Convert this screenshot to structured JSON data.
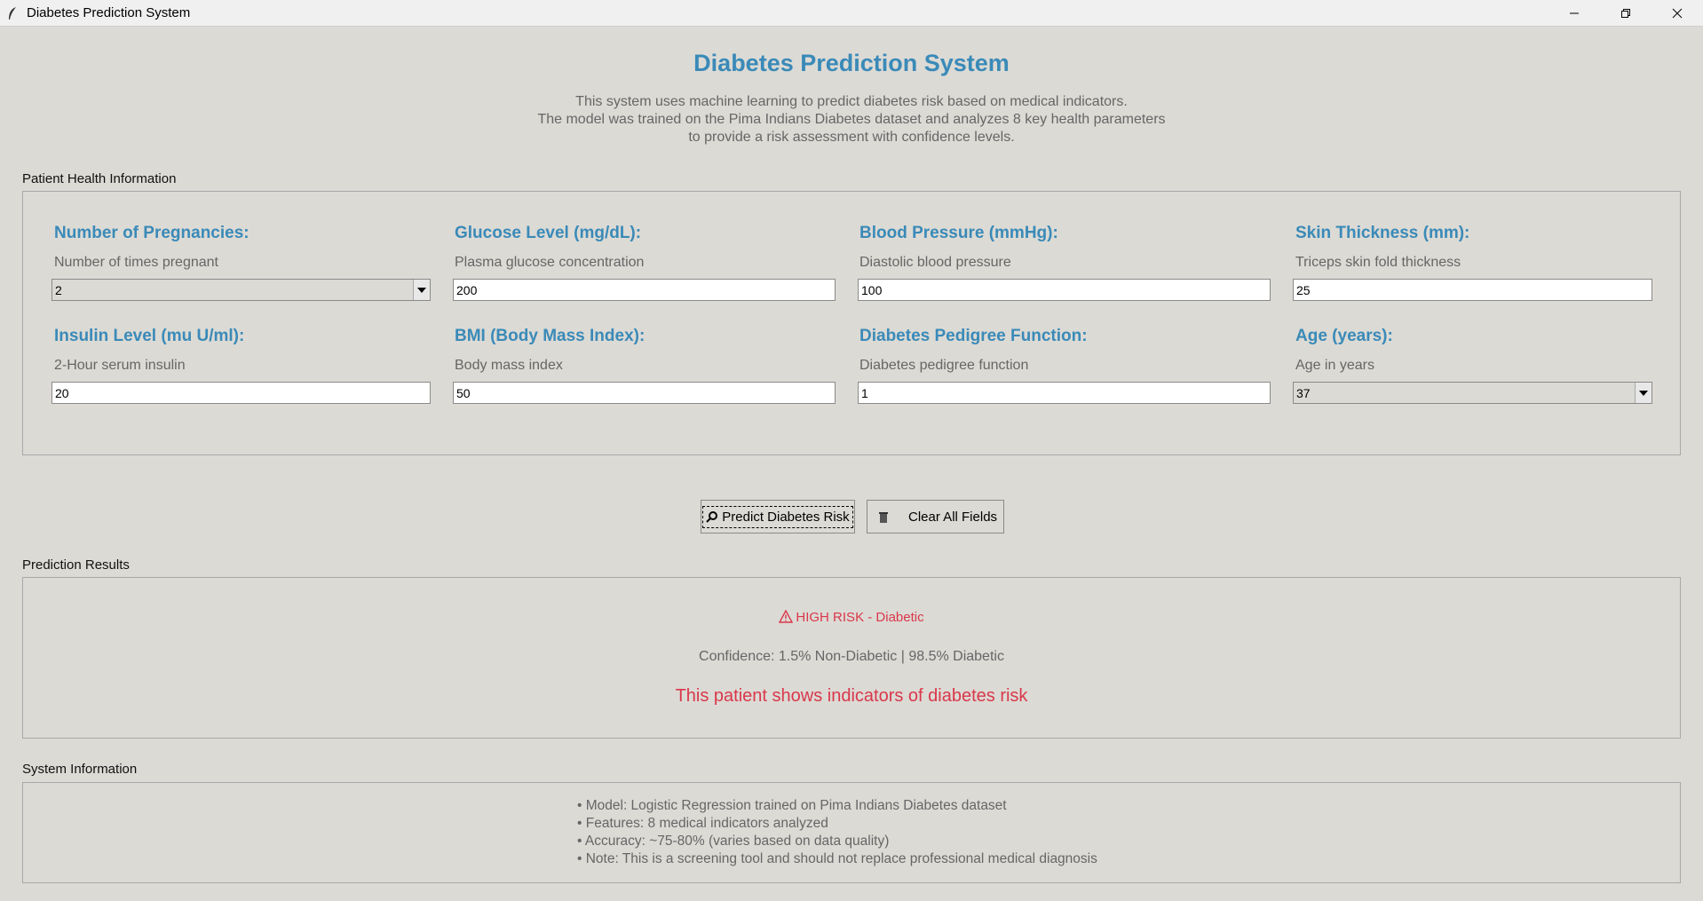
{
  "window": {
    "title": "Diabetes Prediction System"
  },
  "header": {
    "title": "Diabetes Prediction System",
    "description": [
      "This system uses machine learning to predict diabetes risk based on medical indicators.",
      "The model was trained on the Pima Indians Diabetes dataset and analyzes 8 key health parameters",
      "to provide a risk assessment with confidence levels."
    ]
  },
  "patient_section": {
    "label": "Patient Health Information",
    "fields": [
      {
        "title": "Number of Pregnancies:",
        "hint": "Number of times pregnant",
        "value": "2",
        "type": "combobox"
      },
      {
        "title": "Glucose Level (mg/dL):",
        "hint": "Plasma glucose concentration",
        "value": "200",
        "type": "entry"
      },
      {
        "title": "Blood Pressure (mmHg):",
        "hint": "Diastolic blood pressure",
        "value": "100",
        "type": "entry"
      },
      {
        "title": "Skin Thickness (mm):",
        "hint": "Triceps skin fold thickness",
        "value": "25",
        "type": "entry"
      },
      {
        "title": "Insulin Level (mu U/ml):",
        "hint": "2-Hour serum insulin",
        "value": "20",
        "type": "entry"
      },
      {
        "title": "BMI (Body Mass Index):",
        "hint": "Body mass index",
        "value": "50",
        "type": "entry"
      },
      {
        "title": "Diabetes Pedigree Function:",
        "hint": "Diabetes pedigree function",
        "value": "1",
        "type": "entry"
      },
      {
        "title": "Age (years):",
        "hint": "Age in years",
        "value": "37",
        "type": "combobox"
      }
    ]
  },
  "actions": {
    "predict_label": "Predict Diabetes Risk",
    "clear_label": "Clear All Fields"
  },
  "results": {
    "label": "Prediction Results",
    "status": "HIGH RISK - Diabetic",
    "confidence": "Confidence: 1.5% Non-Diabetic | 98.5% Diabetic",
    "message": "This patient shows indicators of diabetes risk"
  },
  "system_info": {
    "label": "System Information",
    "lines": [
      "• Model: Logistic Regression trained on Pima Indians Diabetes dataset",
      "• Features: 8 medical indicators analyzed",
      "• Accuracy: ~75-80% (varies based on data quality)",
      "• Note: This is a screening tool and should not replace professional medical diagnosis"
    ]
  },
  "colors": {
    "accent": "#3a8ab8",
    "danger": "#d9384a",
    "background": "#dcdad5"
  }
}
